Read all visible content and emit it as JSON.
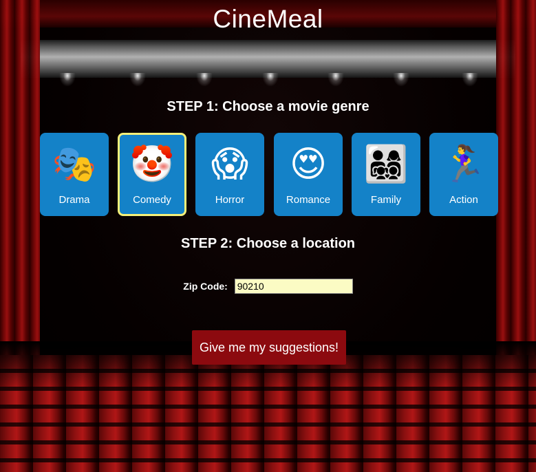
{
  "app": {
    "title": "CineMeal"
  },
  "step1": {
    "heading": "STEP 1: Choose a movie genre",
    "genres": [
      {
        "label": "Drama",
        "icon": "performing-arts-masks-icon",
        "emoji": "🎭",
        "selected": false
      },
      {
        "label": "Comedy",
        "icon": "clown-face-icon",
        "emoji": "🤡",
        "selected": true
      },
      {
        "label": "Horror",
        "icon": "screaming-face-icon",
        "emoji": "😱",
        "selected": false
      },
      {
        "label": "Romance",
        "icon": "heart-eyes-face-icon",
        "emoji": "😍",
        "selected": false
      },
      {
        "label": "Family",
        "icon": "family-icon",
        "emoji": "👨‍👩‍👧‍👦",
        "selected": false
      },
      {
        "label": "Action",
        "icon": "running-person-icon",
        "emoji": "🏃‍♀️",
        "selected": false
      }
    ]
  },
  "step2": {
    "heading": "STEP 2: Choose a location",
    "zip_label": "Zip Code:",
    "zip_value": "90210"
  },
  "submit": {
    "label": "Give me my suggestions!"
  },
  "colors": {
    "tile_blue": "#1482c8",
    "selected_border": "#f5f07a",
    "button_red": "#8c0a0f",
    "input_bg": "#fbfbc4"
  }
}
